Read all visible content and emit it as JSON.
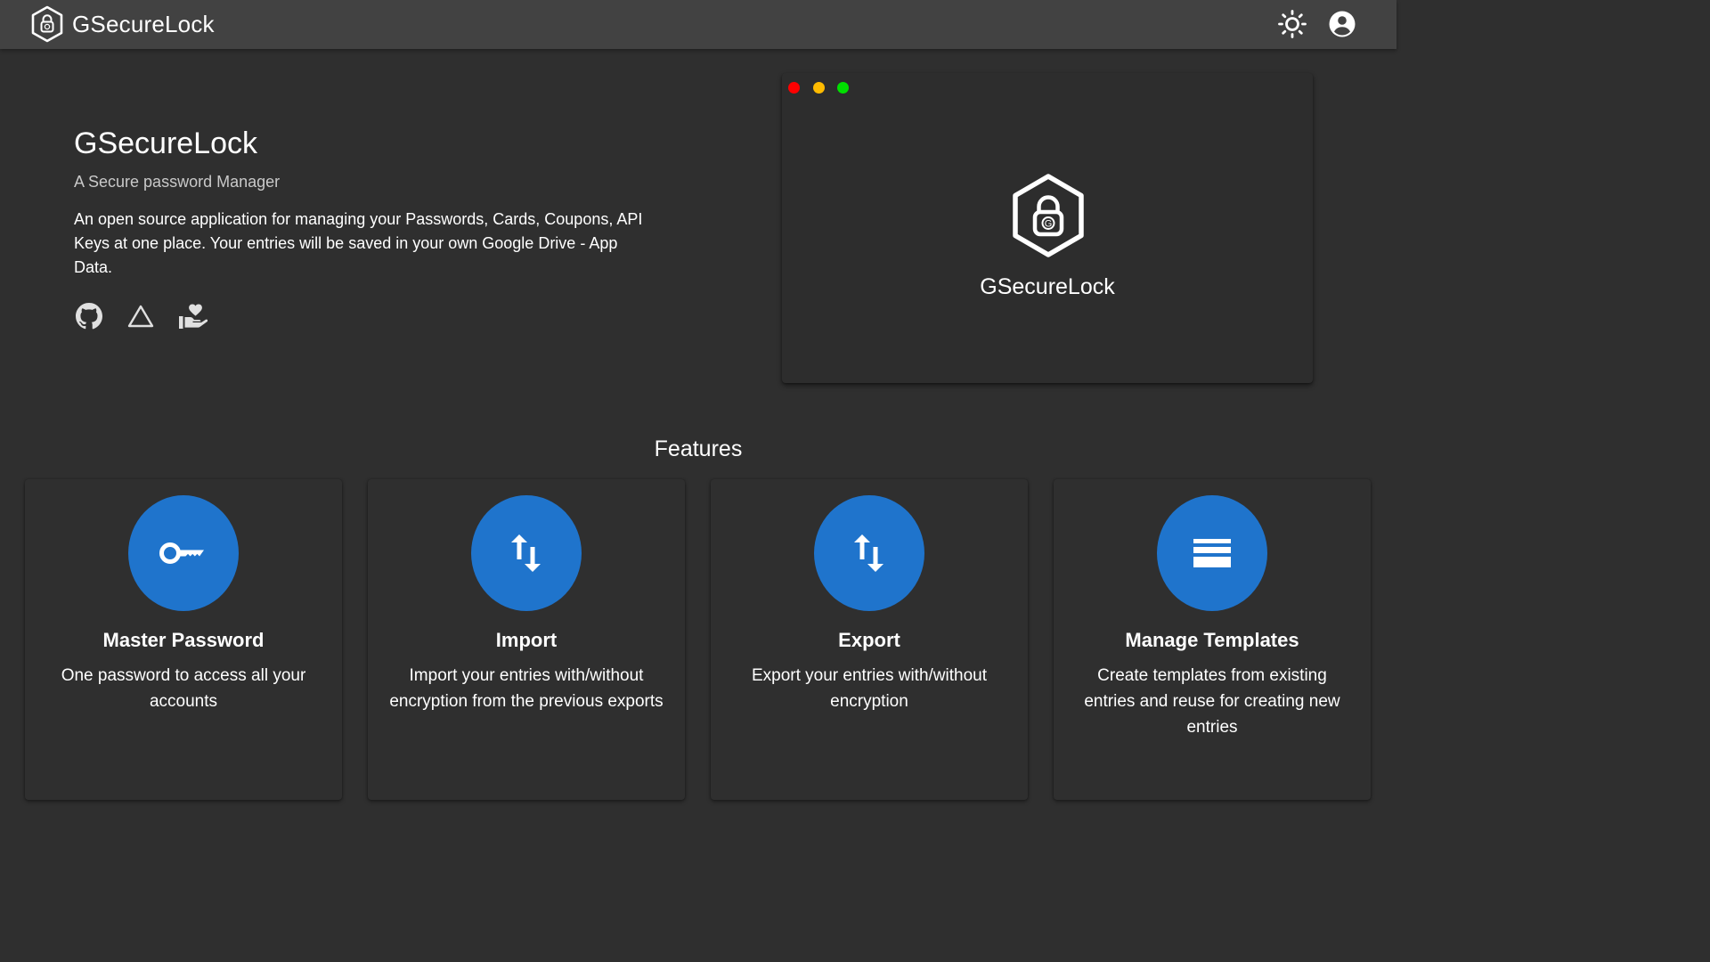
{
  "app": {
    "name": "GSecureLock",
    "logo_icon": "hexagon-lock-icon"
  },
  "topbar": {
    "theme_icon": "sun-icon",
    "account_icon": "account-circle-icon"
  },
  "hero": {
    "title": "GSecureLock",
    "subtitle": "A Secure password Manager",
    "description": "An open source application for managing your Passwords, Cards, Coupons, API Keys at one place. Your entries will be saved in your own Google Drive - App Data.",
    "links": [
      {
        "icon": "github-icon"
      },
      {
        "icon": "google-drive-icon"
      },
      {
        "icon": "donate-hand-heart-icon"
      }
    ]
  },
  "preview": {
    "app_name": "GSecureLock",
    "window_dots": [
      "#ff0000",
      "#ffbb00",
      "#00e000"
    ]
  },
  "features": {
    "heading": "Features",
    "items": [
      {
        "icon": "key-icon",
        "title": "Master Password",
        "description": "One password to access all your accounts"
      },
      {
        "icon": "import-arrows-icon",
        "title": "Import",
        "description": "Import your entries with/without encryption from the previous exports"
      },
      {
        "icon": "export-arrows-icon",
        "title": "Export",
        "description": "Export your entries with/without encryption"
      },
      {
        "icon": "templates-icon",
        "title": "Manage Templates",
        "description": "Create templates from existing entries and reuse for creating new entries"
      }
    ]
  },
  "colors": {
    "background": "#2f2f2f",
    "topbar": "#424242",
    "accent": "#1f74cc"
  }
}
